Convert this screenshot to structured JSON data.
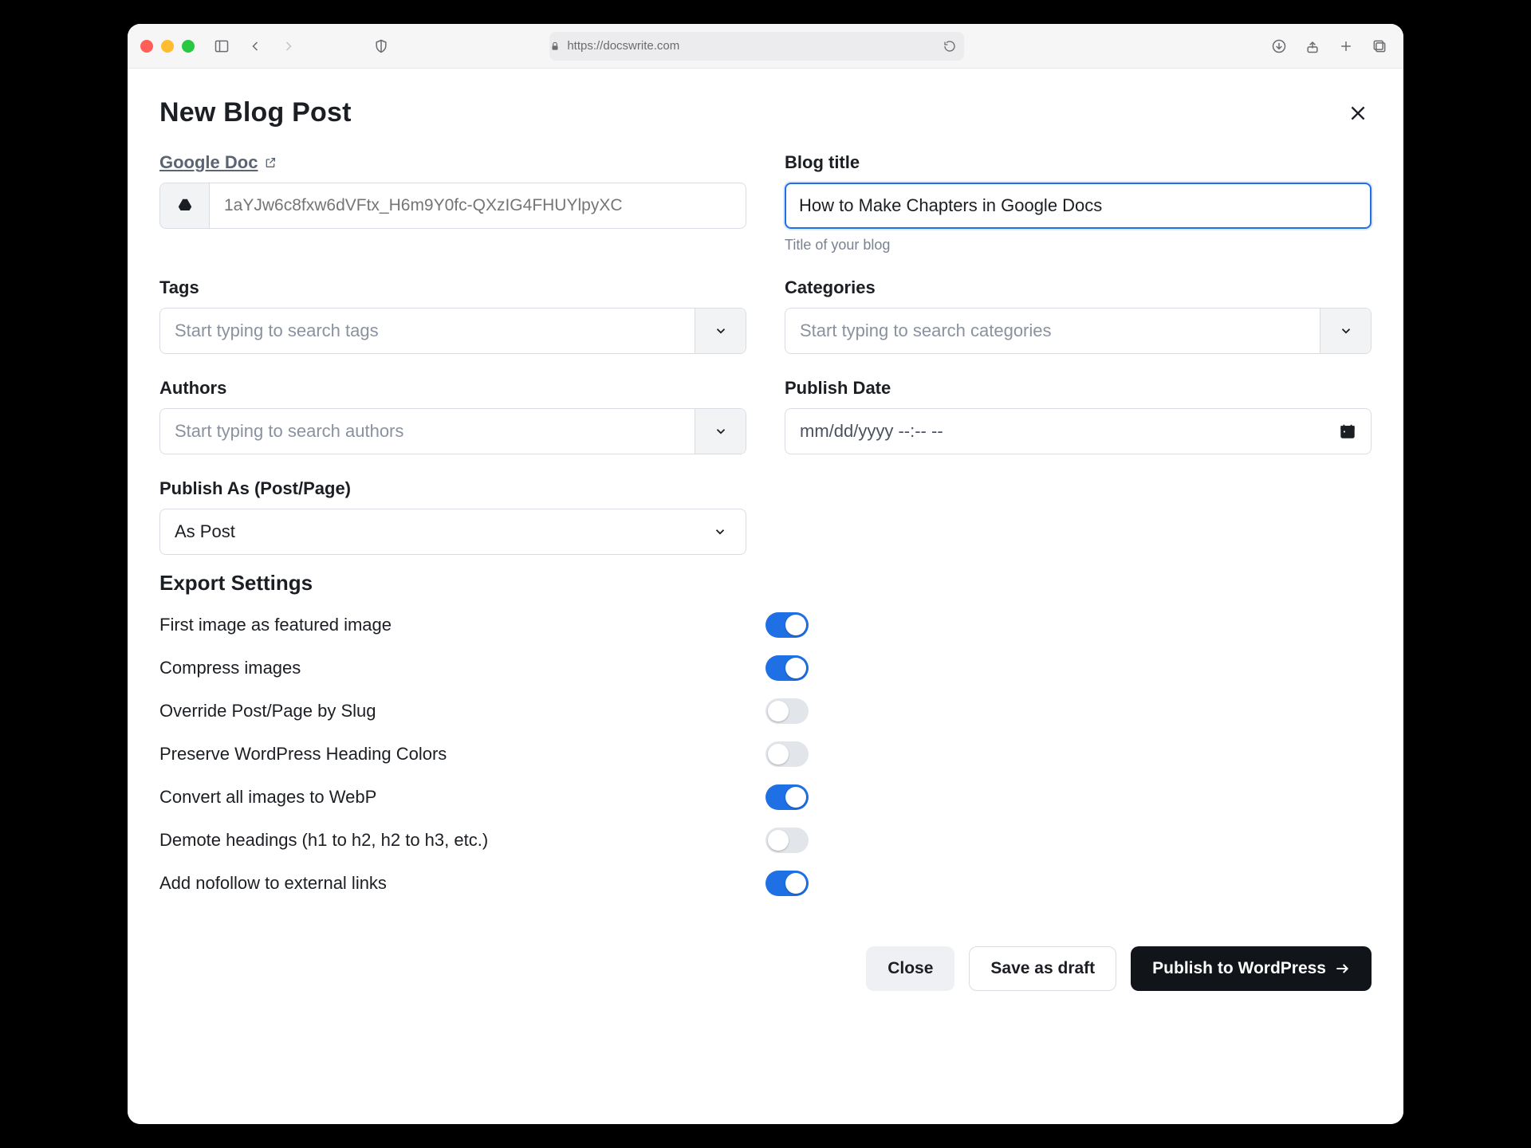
{
  "browser": {
    "url_display": "https://docswrite.com"
  },
  "modal": {
    "title": "New Blog Post",
    "google_doc": {
      "label": "Google Doc",
      "placeholder": "1aYJw6c8fxw6dVFtx_H6m9Y0fc-QXzIG4FHUYlpyXC"
    },
    "blog_title": {
      "label": "Blog title",
      "value": "How to Make Chapters in Google Docs",
      "helper": "Title of your blog"
    },
    "tags": {
      "label": "Tags",
      "placeholder": "Start typing to search tags"
    },
    "categories": {
      "label": "Categories",
      "placeholder": "Start typing to search categories"
    },
    "authors": {
      "label": "Authors",
      "placeholder": "Start typing to search authors"
    },
    "publish_date": {
      "label": "Publish Date",
      "placeholder": "mm/dd/yyyy --:-- --"
    },
    "publish_as": {
      "label": "Publish As (Post/Page)",
      "value": "As Post"
    },
    "export_settings": {
      "heading": "Export Settings",
      "items": [
        {
          "label": "First image as featured image",
          "on": true
        },
        {
          "label": "Compress images",
          "on": true
        },
        {
          "label": "Override Post/Page by Slug",
          "on": false
        },
        {
          "label": "Preserve WordPress Heading Colors",
          "on": false
        },
        {
          "label": "Convert all images to WebP",
          "on": true
        },
        {
          "label": "Demote headings (h1 to h2, h2 to h3, etc.)",
          "on": false
        },
        {
          "label": "Add nofollow to external links",
          "on": true
        }
      ]
    },
    "footer": {
      "close": "Close",
      "save_draft": "Save as draft",
      "publish": "Publish to WordPress"
    }
  }
}
